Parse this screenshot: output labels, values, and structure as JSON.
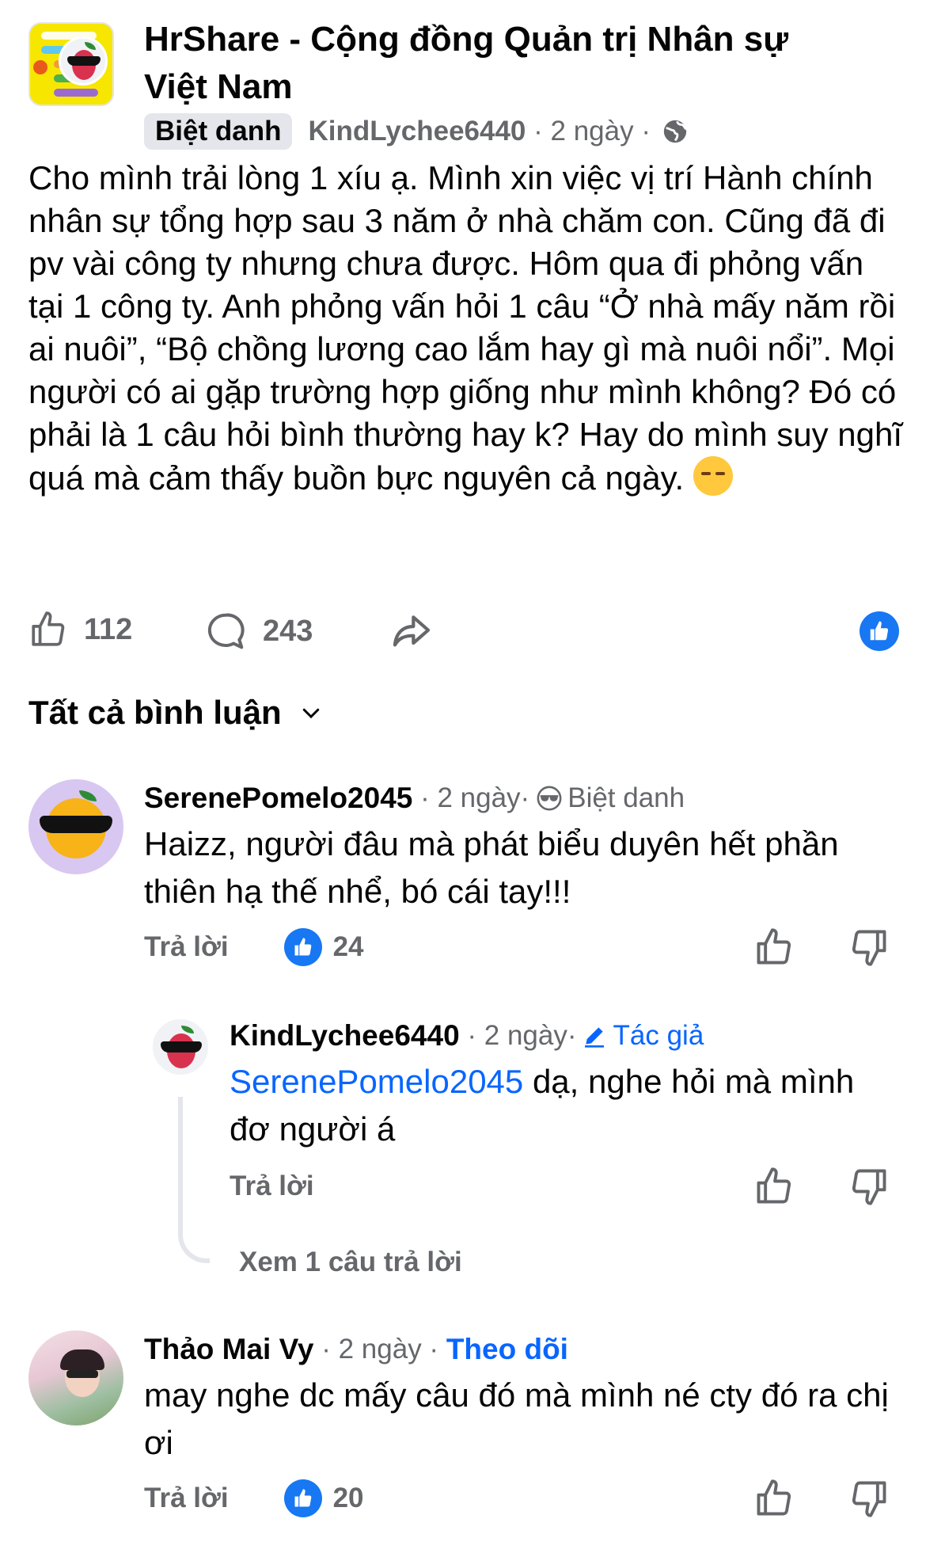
{
  "post": {
    "group_name": "HrShare - Cộng đồng Quản trị Nhân sự Việt Nam",
    "nickname_badge": "Biệt danh",
    "author": "KindLychee6440",
    "sep1": " · ",
    "time": "2 ngày",
    "sep2": " · ",
    "privacy_icon": "globe-icon",
    "body": "Cho mình trải lòng 1 xíu ạ. Mình xin việc vị trí Hành chính nhân sự tổng hợp sau 3 năm ở nhà chăm con. Cũng đã đi pv vài công ty nhưng chưa được. Hôm qua đi phỏng vấn tại 1 công ty. Anh phỏng vấn hỏi 1 câu “Ở nhà mấy năm rồi ai nuôi”, “Bộ chồng lương cao lắm hay gì mà nuôi nổi”. Mọi người có ai gặp trường hợp giống như mình không? Đó có phải là 1 câu hỏi bình thường hay k? Hay do mình suy nghĩ quá mà cảm thấy buồn bực nguyên cả ngày. ",
    "emoji": "pensive-face-emoji",
    "likes": "112",
    "comments": "243"
  },
  "comments_header": {
    "label": "Tất cả bình luận"
  },
  "comments": [
    {
      "name": "SerenePomelo2045",
      "time": " · 2 ngày·",
      "badge": "Biệt danh",
      "text": "Haizz, người đâu mà phát biểu duyên hết phần thiên hạ thế nhể, bó cái tay!!!",
      "reply_label": "Trả lời",
      "likes": "24"
    },
    {
      "name": "KindLychee6440",
      "time": " · 2 ngày·",
      "badge": "Tác giả",
      "mention": "SerenePomelo2045",
      "text": " dạ, nghe hỏi mà mình đơ người á",
      "reply_label": "Trả lời",
      "see_replies": "Xem 1 câu trả lời"
    },
    {
      "name": "Thảo Mai Vy",
      "time": " · 2 ngày · ",
      "follow": "Theo dõi",
      "text": "may nghe dc mấy câu đó mà mình né cty đó ra chị ơi",
      "reply_label": "Trả lời",
      "likes": "20"
    }
  ],
  "colors": {
    "accent": "#0866ff",
    "like_badge": "#1877f2",
    "meta_grey": "#65676b",
    "pill_bg": "#e4e6eb"
  }
}
